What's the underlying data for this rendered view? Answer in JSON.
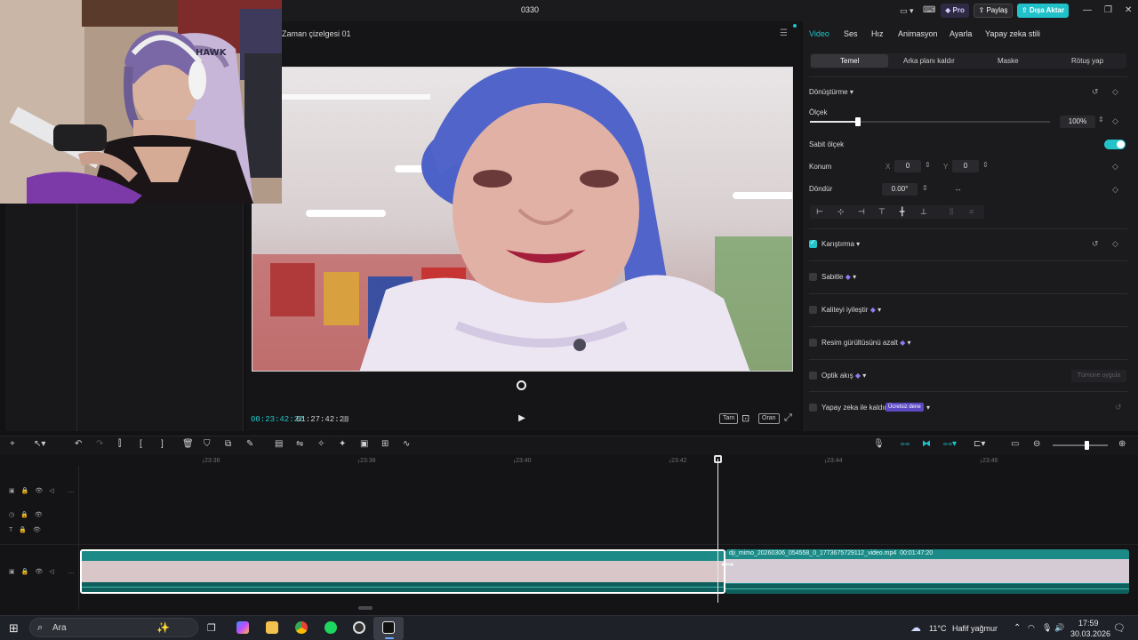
{
  "window": {
    "title": "0330",
    "pro_label": "Pro",
    "share_label": "Paylaş",
    "export_label": "Dışa Aktar"
  },
  "player": {
    "title": "Zaman çizelgesi 01",
    "time_current": "00:23:42:22",
    "time_total": "01:27:42:20",
    "btn_full": "Tam",
    "btn_ratio": "Oran"
  },
  "inspector": {
    "tabs": [
      "Video",
      "Ses",
      "Hız",
      "Animasyon",
      "Ayarla",
      "Yapay zeka stili"
    ],
    "active_tab": "Video",
    "subtabs": [
      "Temel",
      "Arka planı kaldır",
      "Maske",
      "Rötuş yap"
    ],
    "transform": {
      "title": "Dönüştürme",
      "scale_label": "Ölçek",
      "scale_value": "100%",
      "scale_fraction": 0.2,
      "fixed_scale_label": "Sabit ölçek",
      "position_label": "Konum",
      "x_label": "X",
      "x_value": "0",
      "y_label": "Y",
      "y_value": "0",
      "rotate_label": "Döndür",
      "rotate_value": "0.00°"
    },
    "sections": {
      "blend": "Karıştırma",
      "stabilize": "Sabitle",
      "enhance": "Kaliteyi iyileştir",
      "denoise": "Resim gürültüsünü azalt",
      "optical": "Optik akış",
      "optical_btn": "Tümüne uygula",
      "ai_remove": "Yapay zeka ile kaldır",
      "ai_badge": "Ücretsiz dene"
    }
  },
  "timeline": {
    "ticks": [
      "23:36",
      "23:38",
      "23:40",
      "23:42",
      "23:44",
      "23:46"
    ],
    "clip_name": "dji_mimo_20260306_054558_0_1773675729112_video.mp4",
    "clip_duration": "00:01:47:20"
  },
  "taskbar": {
    "search_placeholder": "Ara",
    "weather_temp": "11°C",
    "weather_desc": "Hafif yağmur",
    "time": "17:59",
    "date": "30.03.2026"
  }
}
